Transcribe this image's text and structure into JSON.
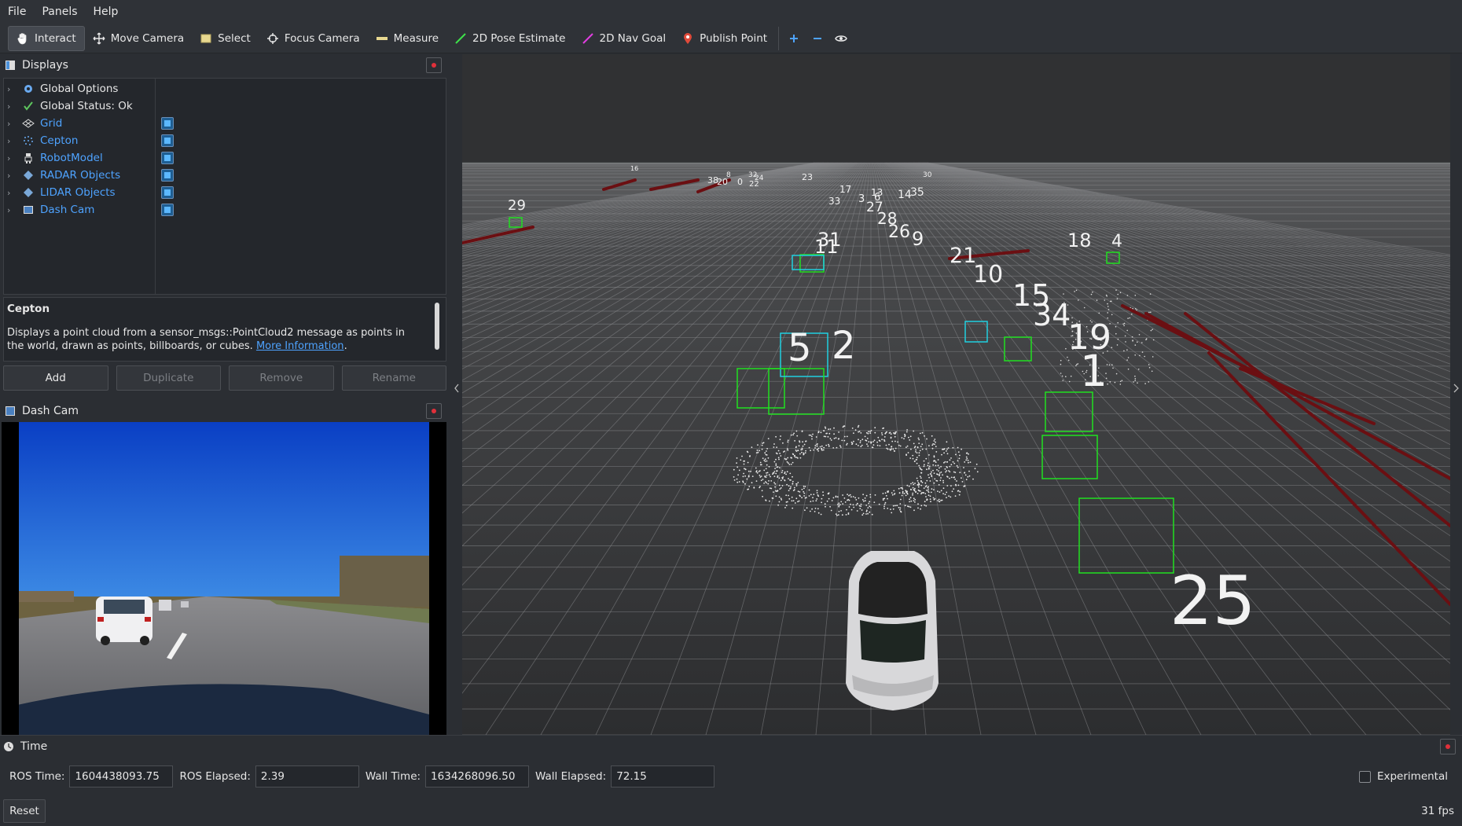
{
  "menu": [
    "File",
    "Panels",
    "Help"
  ],
  "toolbar": {
    "tools": [
      {
        "label": "Interact",
        "icon": "hand-icon",
        "active": true
      },
      {
        "label": "Move Camera",
        "icon": "move-arrows-icon",
        "active": false
      },
      {
        "label": "Select",
        "icon": "select-box-icon",
        "active": false
      },
      {
        "label": "Focus Camera",
        "icon": "crosshair-icon",
        "active": false
      },
      {
        "label": "Measure",
        "icon": "ruler-icon",
        "active": false
      },
      {
        "label": "2D Pose Estimate",
        "icon": "green-arrow-icon",
        "active": false
      },
      {
        "label": "2D Nav Goal",
        "icon": "magenta-arrow-icon",
        "active": false
      },
      {
        "label": "Publish Point",
        "icon": "map-pin-icon",
        "active": false
      }
    ],
    "extra_icons": [
      "plus-icon",
      "minus-icon",
      "eye-icon"
    ]
  },
  "displays": {
    "title": "Displays",
    "items": [
      {
        "label": "Global Options",
        "icon": "gear-icon",
        "blue": false,
        "checked": null
      },
      {
        "label": "Global Status: Ok",
        "icon": "checkmark-icon",
        "blue": false,
        "checked": null
      },
      {
        "label": "Grid",
        "icon": "grid-icon",
        "blue": true,
        "checked": true
      },
      {
        "label": "Cepton",
        "icon": "pointcloud-icon",
        "blue": true,
        "checked": true
      },
      {
        "label": "RobotModel",
        "icon": "robot-icon",
        "blue": true,
        "checked": true
      },
      {
        "label": "RADAR Objects",
        "icon": "marker-icon",
        "blue": true,
        "checked": true
      },
      {
        "label": "LIDAR Objects",
        "icon": "marker-icon",
        "blue": true,
        "checked": true
      },
      {
        "label": "Dash Cam",
        "icon": "image-icon",
        "blue": true,
        "checked": true
      }
    ]
  },
  "description": {
    "title": "Cepton",
    "text": "Displays a point cloud from a sensor_msgs::PointCloud2 message as points in the world, drawn as points, billboards, or cubes.",
    "link": "More Information",
    "end": "."
  },
  "buttons": {
    "add": "Add",
    "duplicate": "Duplicate",
    "remove": "Remove",
    "rename": "Rename"
  },
  "dashcam": {
    "title": "Dash Cam"
  },
  "viewport": {
    "labels": [
      "29",
      "16",
      "38",
      "20",
      "8",
      "0",
      "32",
      "24",
      "22",
      "23",
      "17",
      "13",
      "6",
      "33",
      "14",
      "35",
      "30",
      "3",
      "27",
      "28",
      "26",
      "9",
      "21",
      "10",
      "31",
      "11",
      "18",
      "4",
      "15",
      "34",
      "19",
      "1",
      "5",
      "2",
      "25"
    ]
  },
  "time": {
    "title": "Time",
    "ros_time_label": "ROS Time:",
    "ros_time": "1604438093.75",
    "ros_elapsed_label": "ROS Elapsed:",
    "ros_elapsed": "2.39",
    "wall_time_label": "Wall Time:",
    "wall_time": "1634268096.50",
    "wall_elapsed_label": "Wall Elapsed:",
    "wall_elapsed": "72.15",
    "experimental": "Experimental",
    "experimental_checked": false
  },
  "status": {
    "reset": "Reset",
    "fps": "31 fps"
  }
}
